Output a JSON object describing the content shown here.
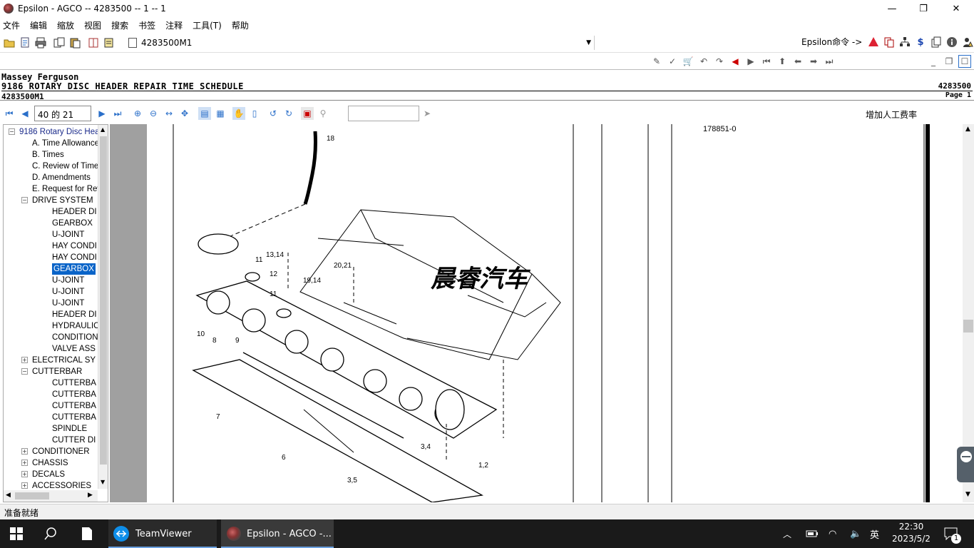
{
  "window": {
    "title": "Epsilon - AGCO -- 4283500 -- 1 -- 1",
    "minimize_glyph": "—",
    "restore_glyph": "❐",
    "close_glyph": "✕"
  },
  "menu": [
    "文件",
    "编辑",
    "缩放",
    "视图",
    "搜索",
    "书签",
    "注释",
    "工具(T)",
    "帮助"
  ],
  "toolbar": {
    "document": "4283500M1",
    "epsilon_command": "Epsilon命令 ->",
    "add_labor_rate": "增加人工费率"
  },
  "doc_header": {
    "brand": "Massey Ferguson",
    "title": "9186 ROTARY DISC HEADER REPAIR TIME SCHEDULE",
    "doc_no": "4283500M1",
    "doc_right": "4283500",
    "page_label": "Page 1"
  },
  "nav": {
    "page_value": "40 的 21"
  },
  "tree": [
    {
      "label": "9186 Rotary Disc Hea",
      "level": 0,
      "expander": "-",
      "root": true
    },
    {
      "label": "A. Time Allowance",
      "level": 1
    },
    {
      "label": "B. Times",
      "level": 1
    },
    {
      "label": "C. Review of Time",
      "level": 1
    },
    {
      "label": "D. Amendments",
      "level": 1
    },
    {
      "label": "E. Request for Rev",
      "level": 1
    },
    {
      "label": "DRIVE SYSTEM",
      "level": 1,
      "expander": "-"
    },
    {
      "label": "HEADER DI",
      "level": 2
    },
    {
      "label": "GEARBOX",
      "level": 2
    },
    {
      "label": "U-JOINT",
      "level": 2
    },
    {
      "label": "HAY CONDI",
      "level": 2
    },
    {
      "label": "HAY CONDI",
      "level": 2
    },
    {
      "label": "GEARBOX",
      "level": 2,
      "selected": true
    },
    {
      "label": "U-JOINT",
      "level": 2
    },
    {
      "label": "U-JOINT",
      "level": 2
    },
    {
      "label": "U-JOINT",
      "level": 2
    },
    {
      "label": "HEADER DI",
      "level": 2
    },
    {
      "label": "HYDRAULIC",
      "level": 2
    },
    {
      "label": "CONDITION",
      "level": 2
    },
    {
      "label": "VALVE ASS",
      "level": 2
    },
    {
      "label": "ELECTRICAL SY",
      "level": 1,
      "expander": "+"
    },
    {
      "label": "CUTTERBAR",
      "level": 1,
      "expander": "-"
    },
    {
      "label": "CUTTERBA",
      "level": 2
    },
    {
      "label": "CUTTERBA",
      "level": 2
    },
    {
      "label": "CUTTERBA",
      "level": 2
    },
    {
      "label": "CUTTERBA",
      "level": 2
    },
    {
      "label": "SPINDLE",
      "level": 2
    },
    {
      "label": "CUTTER DI",
      "level": 2
    },
    {
      "label": "CONDITIONER",
      "level": 1,
      "expander": "+"
    },
    {
      "label": "CHASSIS",
      "level": 1,
      "expander": "+"
    },
    {
      "label": "DECALS",
      "level": 1,
      "expander": "+"
    },
    {
      "label": "ACCESSORIES",
      "level": 1,
      "expander": "+"
    }
  ],
  "drawing": {
    "ref_number": "178851-0",
    "watermark": "晨睿汽车",
    "callouts": [
      "18",
      "13,14",
      "11",
      "12",
      "11",
      "19,14",
      "20,21",
      "10",
      "8",
      "9",
      "7",
      "6",
      "3,4",
      "1,2",
      "3,5"
    ]
  },
  "status": {
    "text": "准备就绪"
  },
  "taskbar": {
    "apps": [
      "TeamViewer",
      "Epsilon - AGCO -..."
    ],
    "ime": "英",
    "time": "22:30",
    "date": "2023/5/2",
    "notification_count": "1"
  }
}
